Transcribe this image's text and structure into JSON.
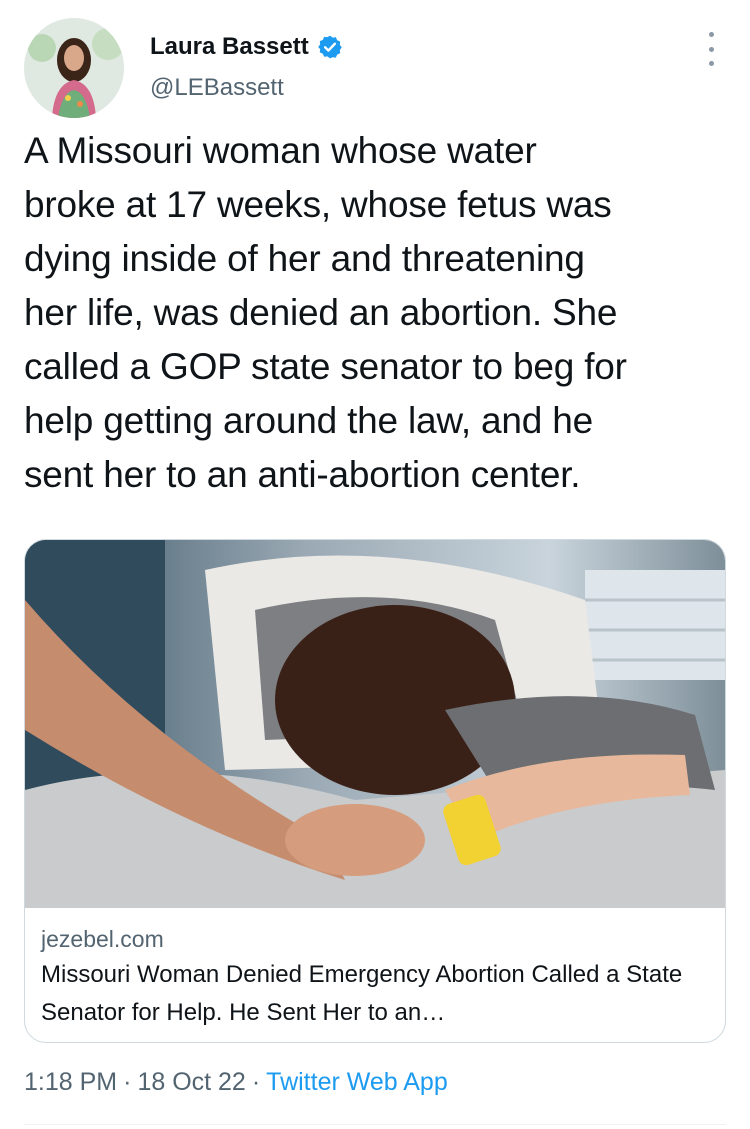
{
  "author": {
    "display_name": "Laura Bassett",
    "handle": "@LEBassett",
    "verified_icon": "verified-badge-icon"
  },
  "tweet": {
    "text": "A Missouri woman whose water\nbroke at 17 weeks, whose fetus was\ndying inside of her and threatening\nher life, was denied an abortion. She\ncalled a GOP state senator to beg for\nhelp getting around the law, and he\nsent her to an anti-abortion center."
  },
  "card": {
    "domain": "jezebel.com",
    "title": "Missouri Woman Denied Emergency Abortion Called a State Senator for Help. He Sent Her to an…"
  },
  "meta": {
    "time": "1:18 PM",
    "date": "18 Oct 22",
    "source": "Twitter Web App",
    "separator": "·"
  },
  "colors": {
    "accent": "#1d9bf0",
    "secondary_text": "#536471",
    "border": "#cfd9de"
  }
}
